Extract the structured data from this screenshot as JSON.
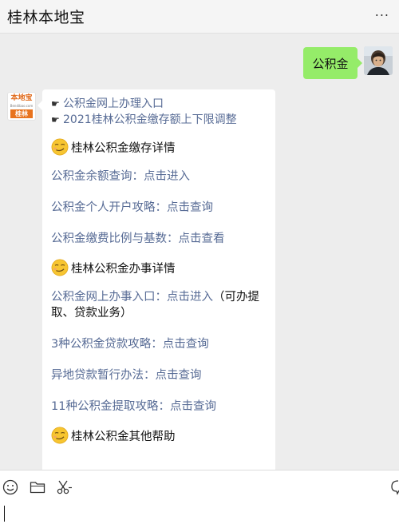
{
  "window": {
    "title": "桂林本地宝",
    "more_label": "..."
  },
  "sent_message": {
    "text": "公积金"
  },
  "account": {
    "logo_text": "本地宝",
    "logo_sub": "Bendibao.com",
    "logo_city": "桂林"
  },
  "reply": {
    "top_links": [
      {
        "hand": "☛",
        "text": "公积金网上办理入口"
      },
      {
        "hand": "☛",
        "text": "2021桂林公积金缴存额上下限调整"
      }
    ],
    "sections": [
      {
        "emoji": "smirk-emoji",
        "title": "桂林公积金缴存详情",
        "items": [
          {
            "text": "公积金余额查询：点击进入",
            "extra": ""
          },
          {
            "text": "公积金个人开户攻略：点击查询",
            "extra": ""
          },
          {
            "text": "公积金缴费比例与基数：点击查看",
            "extra": ""
          }
        ]
      },
      {
        "emoji": "smirk-emoji",
        "title": "桂林公积金办事详情",
        "items": [
          {
            "text": "公积金网上办事入口：点击进入",
            "extra": "（可办提取、贷款业务）"
          },
          {
            "text": "3种公积金贷款攻略：点击查询",
            "extra": ""
          },
          {
            "text": "异地贷款暂行办法：点击查询",
            "extra": ""
          },
          {
            "text": "11种公积金提取攻略：点击查询",
            "extra": ""
          }
        ]
      },
      {
        "emoji": "smirk-emoji",
        "title": "桂林公积金其他帮助",
        "items": []
      }
    ]
  },
  "toolbar": {
    "icons": [
      "emoji-icon",
      "folder-icon",
      "scissors-icon",
      "chat-bubble-icon"
    ]
  },
  "input": {
    "value": ""
  }
}
